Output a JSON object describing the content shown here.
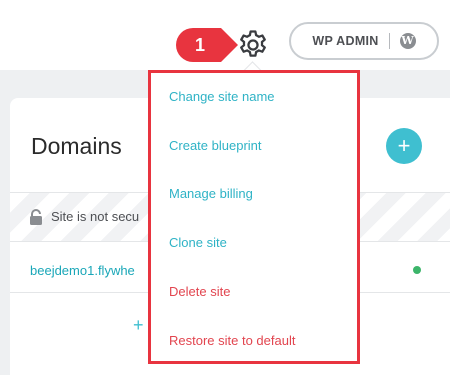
{
  "header": {
    "marker_number": "1",
    "settings_icon": "gear-icon",
    "wp_admin_label": "WP ADMIN",
    "wp_logo_glyph": "W",
    "wp_logo_icon": "wordpress-icon"
  },
  "domains_card": {
    "title": "Domains",
    "add_button_label": "+",
    "security_text": "Site is not secu",
    "domain": "beejdemo1.flywhe",
    "add_link_label": "+"
  },
  "dropdown": {
    "items": [
      {
        "label": "Change site name",
        "kind": "normal"
      },
      {
        "label": "Create blueprint",
        "kind": "normal"
      },
      {
        "label": "Manage billing",
        "kind": "normal"
      },
      {
        "label": "Clone site",
        "kind": "normal"
      },
      {
        "label": "Delete site",
        "kind": "danger"
      },
      {
        "label": "Restore site to default",
        "kind": "danger"
      }
    ]
  },
  "colors": {
    "accent": "#3fbfd0",
    "danger": "#e2454f",
    "highlight_border": "#e8343f",
    "status_ok": "#3cb56a"
  }
}
